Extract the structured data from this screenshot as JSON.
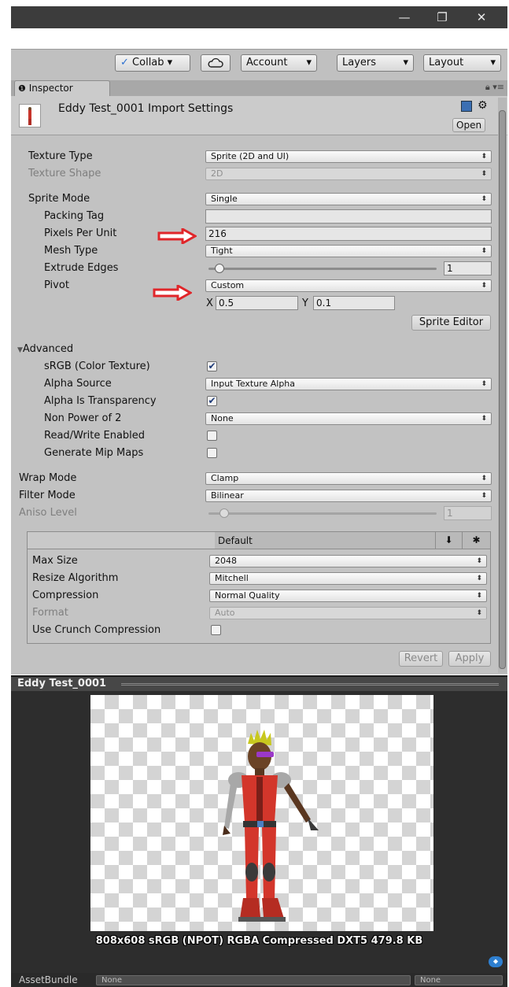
{
  "window": {
    "minimize": "—",
    "maximize": "❐",
    "close": "✕"
  },
  "toolbar": {
    "collab_label": "Collab ▾",
    "cloud_icon": "cloud-icon",
    "account_label": "Account",
    "layers_label": "Layers",
    "layout_label": "Layout",
    "dropdown_arrow": "▾"
  },
  "inspector_tab": {
    "info_icon": "❶",
    "label": "Inspector"
  },
  "header": {
    "title": "Eddy Test_0001 Import Settings",
    "open_label": "Open"
  },
  "fields": {
    "texture_type": {
      "label": "Texture Type",
      "value": "Sprite (2D and UI)"
    },
    "texture_shape": {
      "label": "Texture Shape",
      "value": "2D"
    },
    "sprite_mode": {
      "label": "Sprite Mode",
      "value": "Single"
    },
    "packing_tag": {
      "label": "Packing Tag",
      "value": ""
    },
    "pixels_per_unit": {
      "label": "Pixels Per Unit",
      "value": "216"
    },
    "mesh_type": {
      "label": "Mesh Type",
      "value": "Tight"
    },
    "extrude_edges": {
      "label": "Extrude Edges",
      "value": "1",
      "level": 0.03
    },
    "pivot": {
      "label": "Pivot",
      "value": "Custom",
      "x_label": "X",
      "x_value": "0.5",
      "y_label": "Y",
      "y_value": "0.1"
    },
    "sprite_editor_label": "Sprite Editor"
  },
  "advanced": {
    "label": "Advanced",
    "srgb": {
      "label": "sRGB (Color Texture)",
      "checked": true
    },
    "alpha_source": {
      "label": "Alpha Source",
      "value": "Input Texture Alpha"
    },
    "alpha_is_transparency": {
      "label": "Alpha Is Transparency",
      "checked": true
    },
    "non_power_of_2": {
      "label": "Non Power of 2",
      "value": "None"
    },
    "read_write": {
      "label": "Read/Write Enabled",
      "checked": false
    },
    "mip_maps": {
      "label": "Generate Mip Maps",
      "checked": false
    }
  },
  "wrap_mode": {
    "label": "Wrap Mode",
    "value": "Clamp"
  },
  "filter_mode": {
    "label": "Filter Mode",
    "value": "Bilinear"
  },
  "aniso_level": {
    "label": "Aniso Level",
    "value": "1",
    "level": 0.05
  },
  "platform": {
    "tab_label": "Default",
    "max_size": {
      "label": "Max Size",
      "value": "2048"
    },
    "resize_algorithm": {
      "label": "Resize Algorithm",
      "value": "Mitchell"
    },
    "compression": {
      "label": "Compression",
      "value": "Normal Quality"
    },
    "format": {
      "label": "Format",
      "value": "Auto"
    },
    "crunch": {
      "label": "Use Crunch Compression",
      "checked": false
    }
  },
  "revert_label": "Revert",
  "apply_label": "Apply",
  "preview": {
    "title": "Eddy Test_0001",
    "info": "808x608 sRGB (NPOT)  RGBA Compressed DXT5  479.8 KB"
  },
  "bottom": {
    "assetbundle_label": "AssetBundle",
    "bundle_value": "None",
    "variant_value": "None"
  },
  "colors": {
    "arrow": "#e0262a",
    "accent_check": "#1d3a78"
  }
}
